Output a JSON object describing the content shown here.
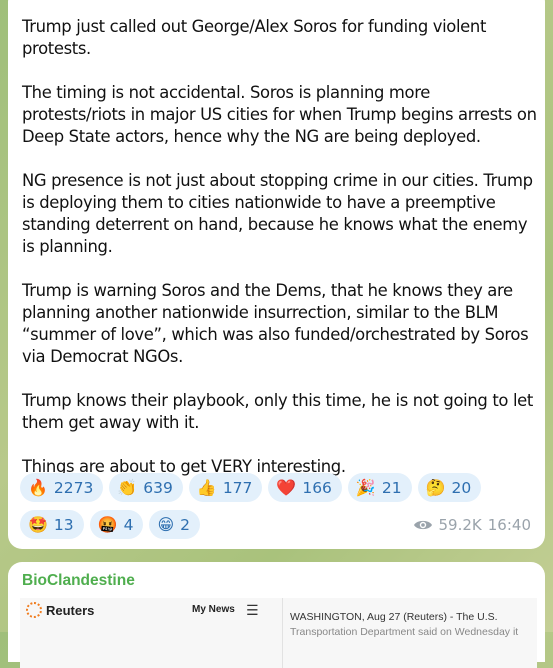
{
  "message1": {
    "paragraphs": [
      "Trump just called out George/Alex Soros for funding violent protests.",
      "The timing is not accidental. Soros is planning more protests/riots in major US cities for when Trump begins arrests on Deep State actors, hence why the NG are being deployed.",
      "NG presence is not just about stopping crime in our cities. Trump is deploying them to cities nationwide to have a preemptive standing deterrent on hand, because he knows what the enemy is planning.",
      "Trump is warning Soros and the Dems, that he knows they are planning another nationwide insurrection, similar to the BLM “summer of love”, which was also funded/orchestrated by Soros via Democrat NGOs.",
      "Trump knows their playbook, only this time, he is not going to let them get away with it.",
      "Things are about to get VERY interesting."
    ],
    "reactions": [
      {
        "emoji": "🔥",
        "icon": "fire-icon",
        "count": "2273"
      },
      {
        "emoji": "👏",
        "icon": "clap-icon",
        "count": "639"
      },
      {
        "emoji": "👍",
        "icon": "thumbs-up-icon",
        "count": "177"
      },
      {
        "emoji": "❤️",
        "icon": "heart-icon",
        "count": "166"
      },
      {
        "emoji": "🎉",
        "icon": "party-icon",
        "count": "21"
      },
      {
        "emoji": "🤔",
        "icon": "thinking-icon",
        "count": "20"
      },
      {
        "emoji": "🤩",
        "icon": "star-struck-icon",
        "count": "13"
      },
      {
        "emoji": "🤬",
        "icon": "cursing-face-icon",
        "count": "4"
      },
      {
        "emoji": "😁",
        "icon": "grin-icon",
        "count": "2"
      }
    ],
    "views": "59.2K",
    "time": "16:40"
  },
  "message2": {
    "author": "BioClandestine",
    "preview": {
      "logo": "Reuters",
      "nav": "My News",
      "article_line1": "WASHINGTON, Aug 27 (Reuters) - The U.S.",
      "article_line2": "Transportation Department said on Wednesday it"
    }
  },
  "colors": {
    "accent": "#2e6fb0",
    "reaction_bg": "#e3f0fb",
    "author": "#4fae4e",
    "meta": "#9aa3ab"
  }
}
